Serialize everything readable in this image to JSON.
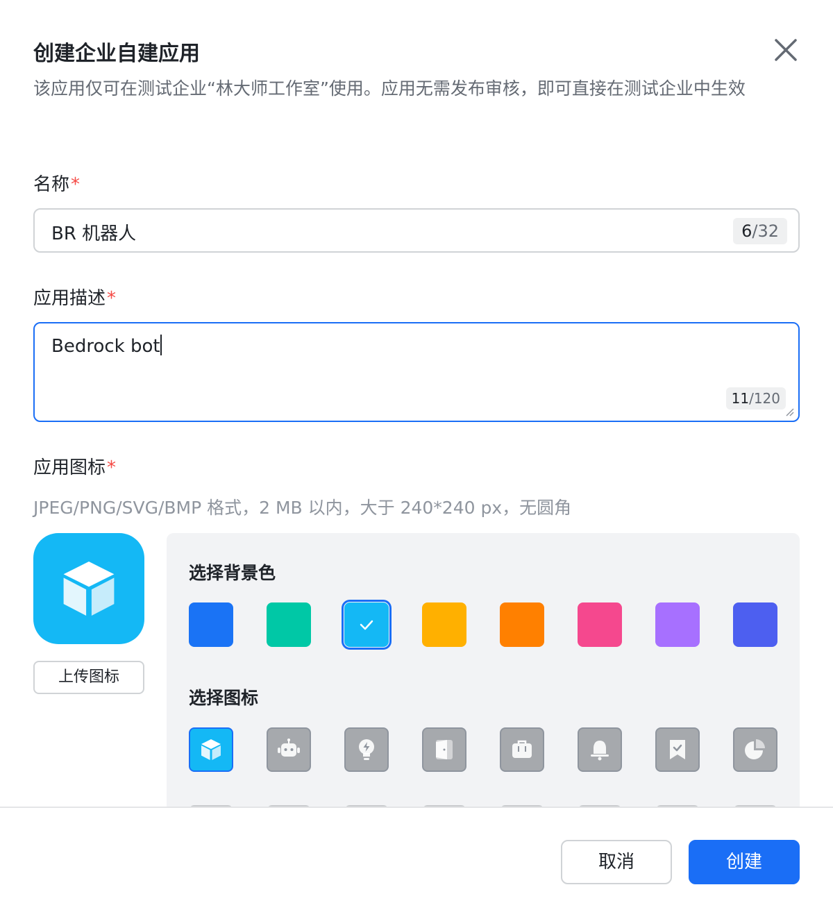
{
  "dialog": {
    "title": "创建企业自建应用",
    "subtitle": "该应用仅可在测试企业“林大师工作室”使用。应用无需发布审核，即可直接在测试企业中生效"
  },
  "name_field": {
    "label": "名称",
    "required_mark": "*",
    "value": "BR 机器人",
    "count_current": "6",
    "count_max": "/32"
  },
  "description_field": {
    "label": "应用描述",
    "required_mark": "*",
    "value": "Bedrock bot",
    "count_current": "11",
    "count_max": "/120"
  },
  "icon_field": {
    "label": "应用图标",
    "required_mark": "*",
    "hint": "JPEG/PNG/SVG/BMP 格式，2 MB 以内，大于 240*240 px，无圆角",
    "upload_label": "上传图标",
    "bg_heading": "选择背景色",
    "icon_heading": "选择图标",
    "bg_colors": [
      "#1a73f5",
      "#00c8a6",
      "#14b8f5",
      "#ffb000",
      "#ff8000",
      "#f5488e",
      "#a770ff",
      "#4d5ff0"
    ],
    "selected_bg_index": 2,
    "icons": [
      "cube-icon",
      "robot-icon",
      "lightbulb-icon",
      "door-icon",
      "briefcase-icon",
      "bell-icon",
      "bookmark-check-icon",
      "pie-chart-icon"
    ],
    "selected_icon_index": 0
  },
  "footer": {
    "cancel_label": "取消",
    "create_label": "创建"
  }
}
